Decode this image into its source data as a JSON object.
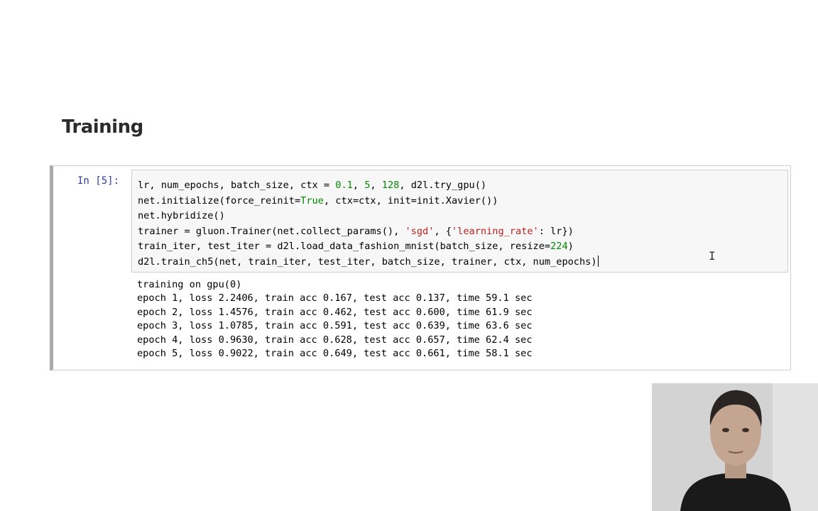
{
  "slide": {
    "title": "Training"
  },
  "cell": {
    "prompt": "In [5]:",
    "code_lines": [
      "lr, num_epochs, batch_size, ctx = 0.1, 5, 128, d2l.try_gpu()",
      "net.initialize(force_reinit=True, ctx=ctx, init=init.Xavier())",
      "net.hybridize()",
      "trainer = gluon.Trainer(net.collect_params(), 'sgd', {'learning_rate': lr})",
      "train_iter, test_iter = d2l.load_data_fashion_mnist(batch_size, resize=224)",
      "d2l.train_ch5(net, train_iter, test_iter, batch_size, trainer, ctx, num_epochs)"
    ],
    "output_lines": [
      "training on gpu(0)",
      "epoch 1, loss 2.2406, train acc 0.167, test acc 0.137, time 59.1 sec",
      "epoch 2, loss 1.4576, train acc 0.462, test acc 0.600, time 61.9 sec",
      "epoch 3, loss 1.0785, train acc 0.591, test acc 0.639, time 63.6 sec",
      "epoch 4, loss 0.9630, train acc 0.628, test acc 0.657, time 62.4 sec",
      "epoch 5, loss 0.9022, train acc 0.649, test acc 0.661, time 58.1 sec"
    ]
  },
  "colors": {
    "prompt": "#303f9f",
    "number": "#008800",
    "string": "#ba2121",
    "input_bg": "#f7f7f7",
    "cell_border_left": "#a9a9a9"
  },
  "icons": {
    "text_cursor": "text-cursor-icon"
  }
}
